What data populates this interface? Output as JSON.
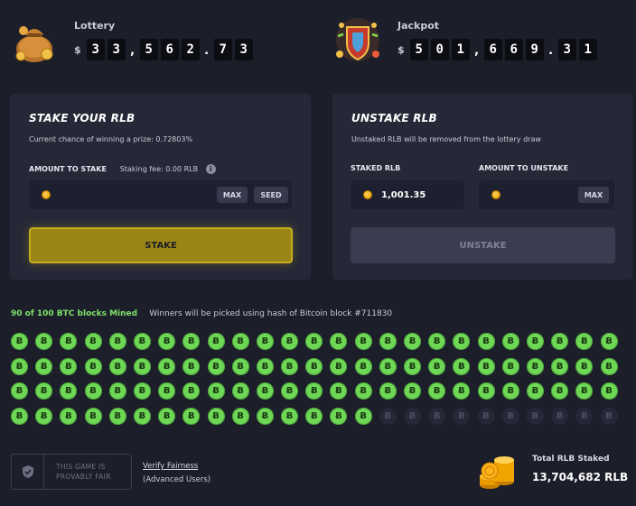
{
  "lottery": {
    "title": "Lottery",
    "currency": "$",
    "chars": [
      "3",
      "3",
      ",",
      "5",
      "6",
      "2",
      ".",
      "7",
      "3"
    ]
  },
  "jackpot": {
    "title": "Jackpot",
    "currency": "$",
    "chars": [
      "5",
      "0",
      "1",
      ",",
      "6",
      "6",
      "9",
      ".",
      "3",
      "1"
    ]
  },
  "stake": {
    "heading": "STAKE YOUR RLB",
    "subtitle": "Current chance of winning a prize: 0.72803%",
    "amount_label": "AMOUNT TO STAKE",
    "fee_label": "Staking fee: 0.00 RLB",
    "info_glyph": "i",
    "max_label": "MAX",
    "seed_label": "SEED",
    "button_label": "STAKE"
  },
  "unstake": {
    "heading": "UNSTAKE RLB",
    "subtitle": "Unstaked RLB will be removed from the lottery draw",
    "staked_label": "STAKED RLB",
    "staked_value": "1,001.35",
    "amount_label": "AMOUNT TO UNSTAKE",
    "max_label": "MAX",
    "button_label": "UNSTAKE"
  },
  "blocks": {
    "mined_text": "90 of 100 BTC blocks Mined",
    "winners_text": "Winners will be picked using hash of Bitcoin block #711830",
    "mined": 90,
    "total": 100,
    "per_row": 25,
    "glyph": "Ƀ"
  },
  "footer": {
    "fair_line1": "THIS GAME IS",
    "fair_line2": "PROVABLY FAIR",
    "verify_label": "Verify Fairness",
    "verify_sub": "(Advanced Users)",
    "total_label": "Total RLB Staked",
    "total_value": "13,704,682 RLB"
  },
  "colors": {
    "background": "#1c1e2a",
    "panel": "#262837",
    "stake_button": "#9a8616",
    "mined_block": "#6fd756",
    "coin": "#ffb21a"
  },
  "icons": {
    "lottery_art": "money-bag-icon",
    "jackpot_art": "jackpot-shield-icon",
    "fair_icon": "shield-check-icon",
    "total_art": "coin-stack-icon"
  }
}
